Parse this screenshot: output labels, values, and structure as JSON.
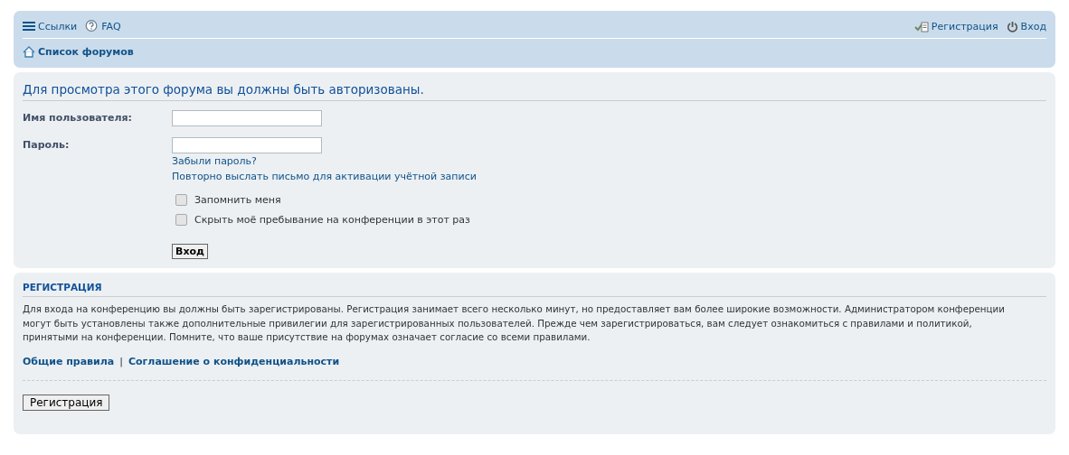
{
  "header": {
    "links_left": [
      {
        "kind": "menu",
        "label": "Ссылки"
      },
      {
        "kind": "faq",
        "label": "FAQ"
      }
    ],
    "links_right": [
      {
        "kind": "register",
        "label": "Регистрация"
      },
      {
        "kind": "login",
        "label": "Вход"
      }
    ],
    "breadcrumb": "Список форумов"
  },
  "login": {
    "title": "Для просмотра этого форума вы должны быть авторизованы.",
    "fields": [
      {
        "label": "Имя пользователя:"
      },
      {
        "label": "Пароль:"
      }
    ],
    "links": [
      "Забыли пароль?",
      "Повторно выслать письмо для активации учётной записи"
    ],
    "checkboxes": [
      {
        "label": "Запомнить меня",
        "checked": false
      },
      {
        "label": "Скрыть моё пребывание на конференции в этот раз",
        "checked": false
      }
    ],
    "button": "Вход"
  },
  "registration": {
    "title": "РЕГИСТРАЦИЯ",
    "text": "Для входа на конференцию вы должны быть зарегистрированы. Регистрация занимает всего несколько минут, но предоставляет вам более широкие возможности. Администратором конференции могут быть установлены также дополнительные привилегии для зарегистрированных пользователей. Прежде чем зарегистрироваться, вам следует ознакомиться с правилами и политикой, принятыми на конференции. Помните, что ваше присутствие на форумах означает согласие со всеми правилами.",
    "links": [
      "Общие правила",
      "Соглашение о конфиденциальности"
    ],
    "separator": "|",
    "button": "Регистрация"
  }
}
